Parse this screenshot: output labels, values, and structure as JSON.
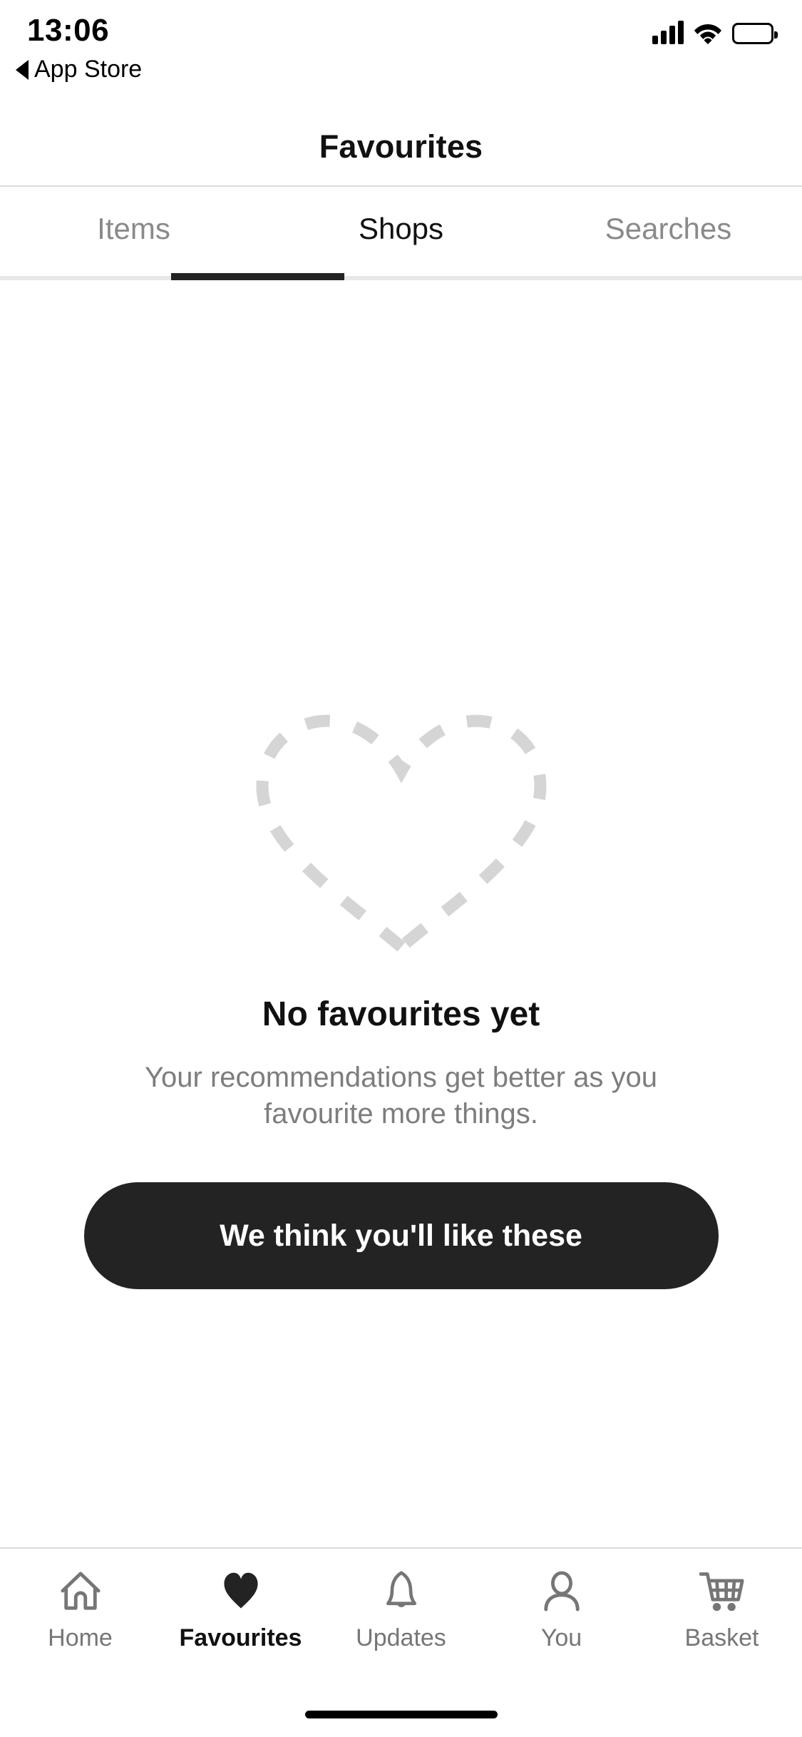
{
  "status_bar": {
    "time": "13:06",
    "back_label": "App Store",
    "back_arrow_icon": "triangle-left-icon",
    "signal_icon": "cellular-signal-icon",
    "wifi_icon": "wifi-icon",
    "battery_icon": "battery-full-icon"
  },
  "header": {
    "title": "Favourites"
  },
  "segmented_tabs": {
    "active_index": 1,
    "items": [
      {
        "label": "Items"
      },
      {
        "label": "Shops"
      },
      {
        "label": "Searches"
      }
    ]
  },
  "empty_state": {
    "illustration_icon": "dashed-heart-icon",
    "title": "No favourites yet",
    "subtitle": "Your recommendations get better as you favourite more things.",
    "cta_label": "We think you'll like these"
  },
  "bottom_nav": {
    "active_index": 1,
    "items": [
      {
        "label": "Home",
        "icon": "house-icon"
      },
      {
        "label": "Favourites",
        "icon": "heart-filled-icon"
      },
      {
        "label": "Updates",
        "icon": "bell-icon"
      },
      {
        "label": "You",
        "icon": "person-icon"
      },
      {
        "label": "Basket",
        "icon": "shopping-cart-icon"
      }
    ]
  },
  "colors": {
    "accent_dark": "#232323",
    "text_primary": "#111111",
    "text_muted": "#7d7d7d",
    "tab_label": "#767676",
    "divider": "#dcdcdc",
    "illustration": "#d5d5d5"
  }
}
